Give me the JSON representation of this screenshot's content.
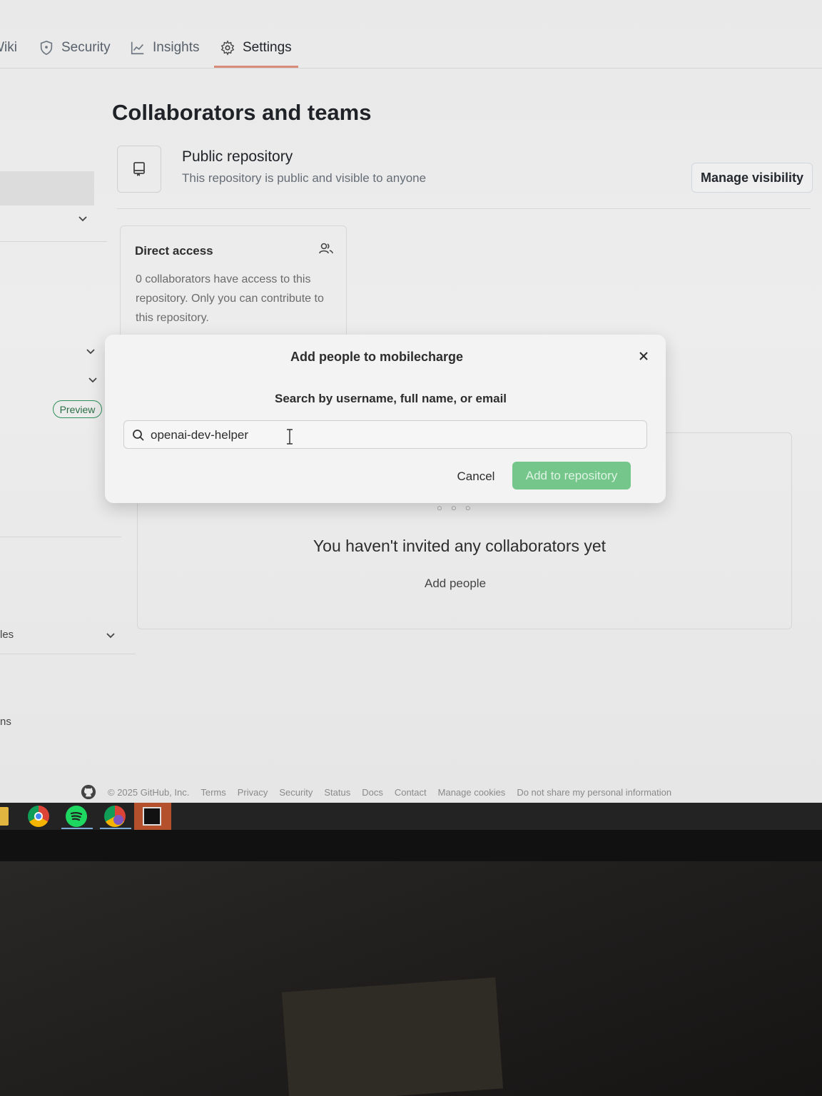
{
  "tabs": [
    {
      "label": "Wiki"
    },
    {
      "label": "Security"
    },
    {
      "label": "Insights"
    },
    {
      "label": "Settings"
    }
  ],
  "sidebar": {
    "preview_badge": "Preview",
    "fragment_1": "les",
    "fragment_2": "ns"
  },
  "main": {
    "title": "Collaborators and teams",
    "visibility": {
      "title": "Public repository",
      "description": "This repository is public and visible to anyone",
      "button": "Manage visibility"
    },
    "direct_access": {
      "title": "Direct access",
      "body": "0 collaborators have access to this repository. Only you can contribute to this repository."
    },
    "empty_state": {
      "title": "You haven't invited any collaborators yet",
      "link": "Add people"
    }
  },
  "modal": {
    "title": "Add people to mobilecharge",
    "search_label": "Search by username, full name, or email",
    "search_value": "openai-dev-helper",
    "cancel": "Cancel",
    "submit": "Add to repository"
  },
  "footer": {
    "copyright": "© 2025 GitHub, Inc.",
    "links": [
      "Terms",
      "Privacy",
      "Security",
      "Status",
      "Docs",
      "Contact",
      "Manage cookies",
      "Do not share my personal information"
    ]
  },
  "taskbar": {
    "apps": [
      "file-explorer",
      "chrome",
      "spotify",
      "chrome-profile",
      "terminal"
    ]
  },
  "colors": {
    "accent_green": "#74c68a",
    "tab_underline": "#d98c7a",
    "preview_green": "#2e8f5a"
  }
}
